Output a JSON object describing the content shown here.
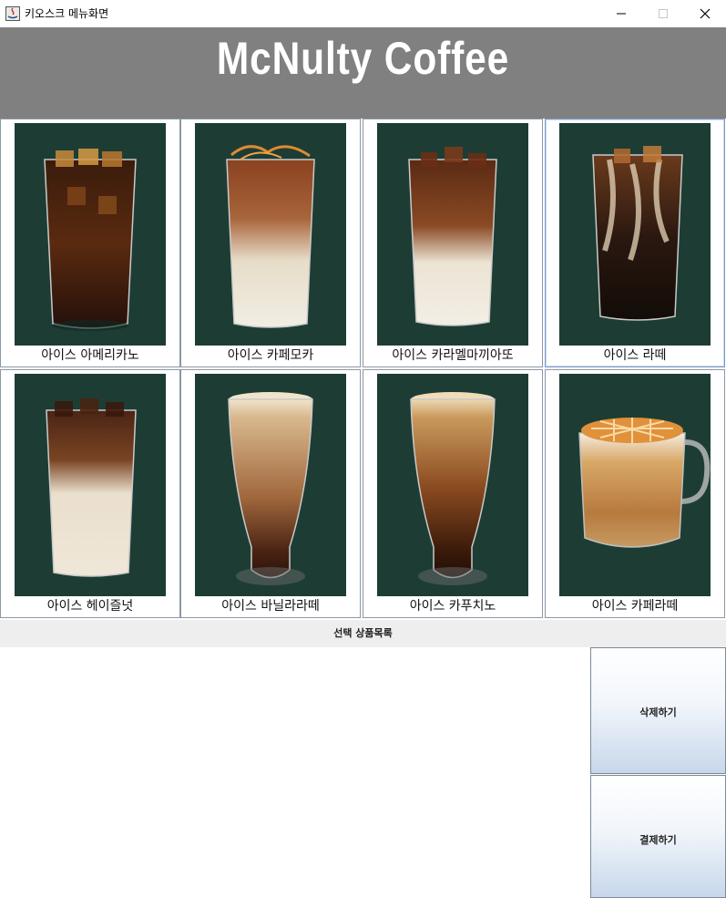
{
  "window": {
    "title": "키오스크 메뉴화면"
  },
  "header": {
    "brand": "McNulty Coffee"
  },
  "menu": [
    {
      "name": "아이스 아메리카노",
      "drink": "iced-americano"
    },
    {
      "name": "아이스 카페모카",
      "drink": "iced-cafe-mocha"
    },
    {
      "name": "아이스 카라멜마끼아또",
      "drink": "iced-caramel-macchiato"
    },
    {
      "name": "아이스 라떼",
      "drink": "iced-latte",
      "selected": true
    },
    {
      "name": "아이스 헤이즐넛",
      "drink": "iced-hazelnut"
    },
    {
      "name": "아이스 바닐라라떼",
      "drink": "iced-vanilla-latte"
    },
    {
      "name": "아이스 카푸치노",
      "drink": "iced-cappuccino"
    },
    {
      "name": "아이스 카페라떼",
      "drink": "iced-cafe-latte"
    }
  ],
  "order": {
    "section_label": "선택 상품목록",
    "items": []
  },
  "actions": {
    "delete_label": "삭제하기",
    "pay_label": "결제하기"
  },
  "colors": {
    "header_bg": "#808080",
    "photo_bg": "#1d3d34",
    "brand_text": "#ffffff"
  }
}
